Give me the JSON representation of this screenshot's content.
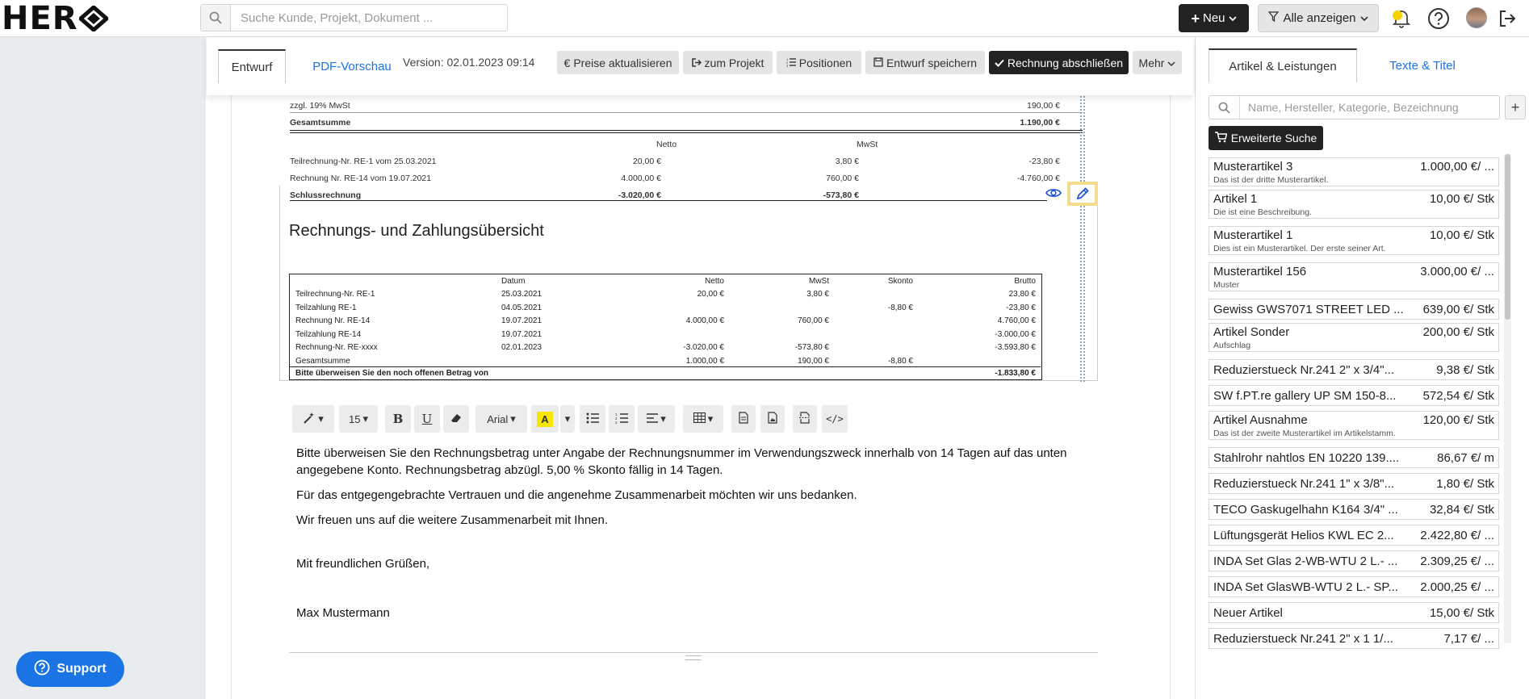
{
  "brand": {
    "logo_text": "HER"
  },
  "topbar": {
    "search_placeholder": "Suche Kunde, Projekt, Dokument ...",
    "new_label": "Neu",
    "filter_label": "Alle anzeigen"
  },
  "support_label": "Support",
  "doc_tabs": {
    "draft": "Entwurf",
    "pdf_preview": "PDF-Vorschau",
    "version": "Version: 02.01.2023 09:14"
  },
  "doc_actions": {
    "update_prices": "Preise aktualisieren",
    "to_project": "zum Projekt",
    "positions": "Positionen",
    "save_draft": "Entwurf speichern",
    "finish_invoice": "Rechnung abschließen",
    "more": "Mehr"
  },
  "preview": {
    "vat_label": "zzgl. 19% MwSt",
    "vat_value": "190,00 €",
    "total_label": "Gesamtsumme",
    "total_value": "1.190,00 €",
    "col_netto": "Netto",
    "col_mwst": "MwSt",
    "rows": [
      {
        "label": "Teilrechnung-Nr. RE-1 vom 25.03.2021",
        "netto": "20,00 €",
        "mwst": "3,80 €",
        "brutto": "-23,80 €"
      },
      {
        "label": "Rechnung Nr. RE-14 vom 19.07.2021",
        "netto": "4.000,00 €",
        "mwst": "760,00 €",
        "brutto": "-4.760,00 €"
      },
      {
        "label": "Schlussrechnung",
        "netto": "-3.020,00 €",
        "mwst": "-573,80 €",
        "brutto": ""
      }
    ],
    "heading": "Rechnungs- und Zahlungsübersicht",
    "overview_headers": {
      "datum": "Datum",
      "netto": "Netto",
      "mwst": "MwSt",
      "skonto": "Skonto",
      "brutto": "Brutto"
    },
    "overview_rows": [
      {
        "label": "Teilrechnung-Nr. RE-1",
        "datum": "25.03.2021",
        "netto": "20,00 €",
        "mwst": "3,80 €",
        "skonto": "",
        "brutto": "23,80 €"
      },
      {
        "label": "Teilzahlung RE-1",
        "datum": "04.05.2021",
        "netto": "",
        "mwst": "",
        "skonto": "-8,80 €",
        "brutto": "-23,80 €"
      },
      {
        "label": "Rechnung Nr. RE-14",
        "datum": "19.07.2021",
        "netto": "4.000,00 €",
        "mwst": "760,00 €",
        "skonto": "",
        "brutto": "4.760,00 €"
      },
      {
        "label": "Teilzahlung RE-14",
        "datum": "19.07.2021",
        "netto": "",
        "mwst": "",
        "skonto": "",
        "brutto": "-3.000,00 €"
      },
      {
        "label": "Rechnung-Nr. RE-xxxx",
        "datum": "02.01.2023",
        "netto": "-3.020,00 €",
        "mwst": "-573,80 €",
        "skonto": "",
        "brutto": "-3.593,80 €"
      },
      {
        "label": "Gesamtsumme",
        "datum": "",
        "netto": "1.000,00 €",
        "mwst": "190,00 €",
        "skonto": "-8,80 €",
        "brutto": ""
      },
      {
        "label": "Bitte überweisen Sie den noch offenen Betrag von",
        "datum": "",
        "netto": "",
        "mwst": "",
        "skonto": "",
        "brutto": "-1.833,80 €"
      }
    ]
  },
  "editor_toolbar": {
    "font_size": "15",
    "font_family": "Arial"
  },
  "editor": {
    "p1": "Bitte überweisen Sie den Rechnungsbetrag unter Angabe der Rechnungsnummer im Verwendungszweck innerhalb von 14 Tagen auf das unten angegebene Konto. Rechnungsbetrag abzügl. 5,00 % Skonto fällig in 14 Tagen.",
    "p2": "Für das entgegengebrachte Vertrauen und die angenehme Zusammenarbeit möchten wir uns bedanken.",
    "p3": "Wir freuen uns auf die weitere Zusammenarbeit mit Ihnen.",
    "p4": "Mit freundlichen Grüßen,",
    "p5": "Max Mustermann"
  },
  "sidebar": {
    "tab_articles": "Artikel & Leistungen",
    "tab_texts": "Texte & Titel",
    "search_placeholder": "Name, Hersteller, Kategorie, Bezeichnung",
    "advanced_search": "Erweiterte Suche",
    "items": [
      {
        "name": "Musterartikel 3",
        "price": "1.000,00 €/ ...",
        "desc": "Das ist der dritte Musterartikel."
      },
      {
        "name": "Artikel 1",
        "price": "10,00 €/ Stk",
        "desc": "Die ist eine Beschreibung."
      },
      {
        "name": "Musterartikel 1",
        "price": "10,00 €/ Stk",
        "desc": "Dies ist ein Musterartikel. Der erste seiner Art."
      },
      {
        "name": "Musterartikel 156",
        "price": "3.000,00 €/ ...",
        "desc": "Muster"
      },
      {
        "name": "Gewiss GWS7071 STREET LED ...",
        "price": "639,00 €/ Stk",
        "desc": ""
      },
      {
        "name": "Artikel Sonder",
        "price": "200,00 €/ Stk",
        "desc": "Aufschlag"
      },
      {
        "name": "Reduzierstueck Nr.241 2\" x 3/4\"...",
        "price": "9,38 €/ Stk",
        "desc": ""
      },
      {
        "name": "SW f.PT.re gallery UP SM 150-8...",
        "price": "572,54 €/ Stk",
        "desc": ""
      },
      {
        "name": "Artikel Ausnahme",
        "price": "120,00 €/ Stk",
        "desc": "Das ist der zweite Musterartikel im Artikelstamm."
      },
      {
        "name": "Stahlrohr nahtlos EN 10220 139....",
        "price": "86,67 €/ m",
        "desc": ""
      },
      {
        "name": "Reduzierstueck Nr.241 1\" x 3/8\"...",
        "price": "1,80 €/ Stk",
        "desc": ""
      },
      {
        "name": "TECO Gaskugelhahn K164 3/4\" ...",
        "price": "32,84 €/ Stk",
        "desc": ""
      },
      {
        "name": "Lüftungsgerät Helios KWL EC 2...",
        "price": "2.422,80 €/ ...",
        "desc": ""
      },
      {
        "name": "INDA Set Glas 2-WB-WTU 2 L.- ...",
        "price": "2.309,25 €/ ...",
        "desc": ""
      },
      {
        "name": "INDA Set GlasWB-WTU 2 L.- SP...",
        "price": "2.000,25 €/ ...",
        "desc": ""
      },
      {
        "name": "Neuer Artikel",
        "price": "15,00 €/ Stk",
        "desc": ""
      },
      {
        "name": "Reduzierstueck Nr.241 2\" x 1 1/...",
        "price": "7,17 €/ ...",
        "desc": ""
      }
    ]
  }
}
